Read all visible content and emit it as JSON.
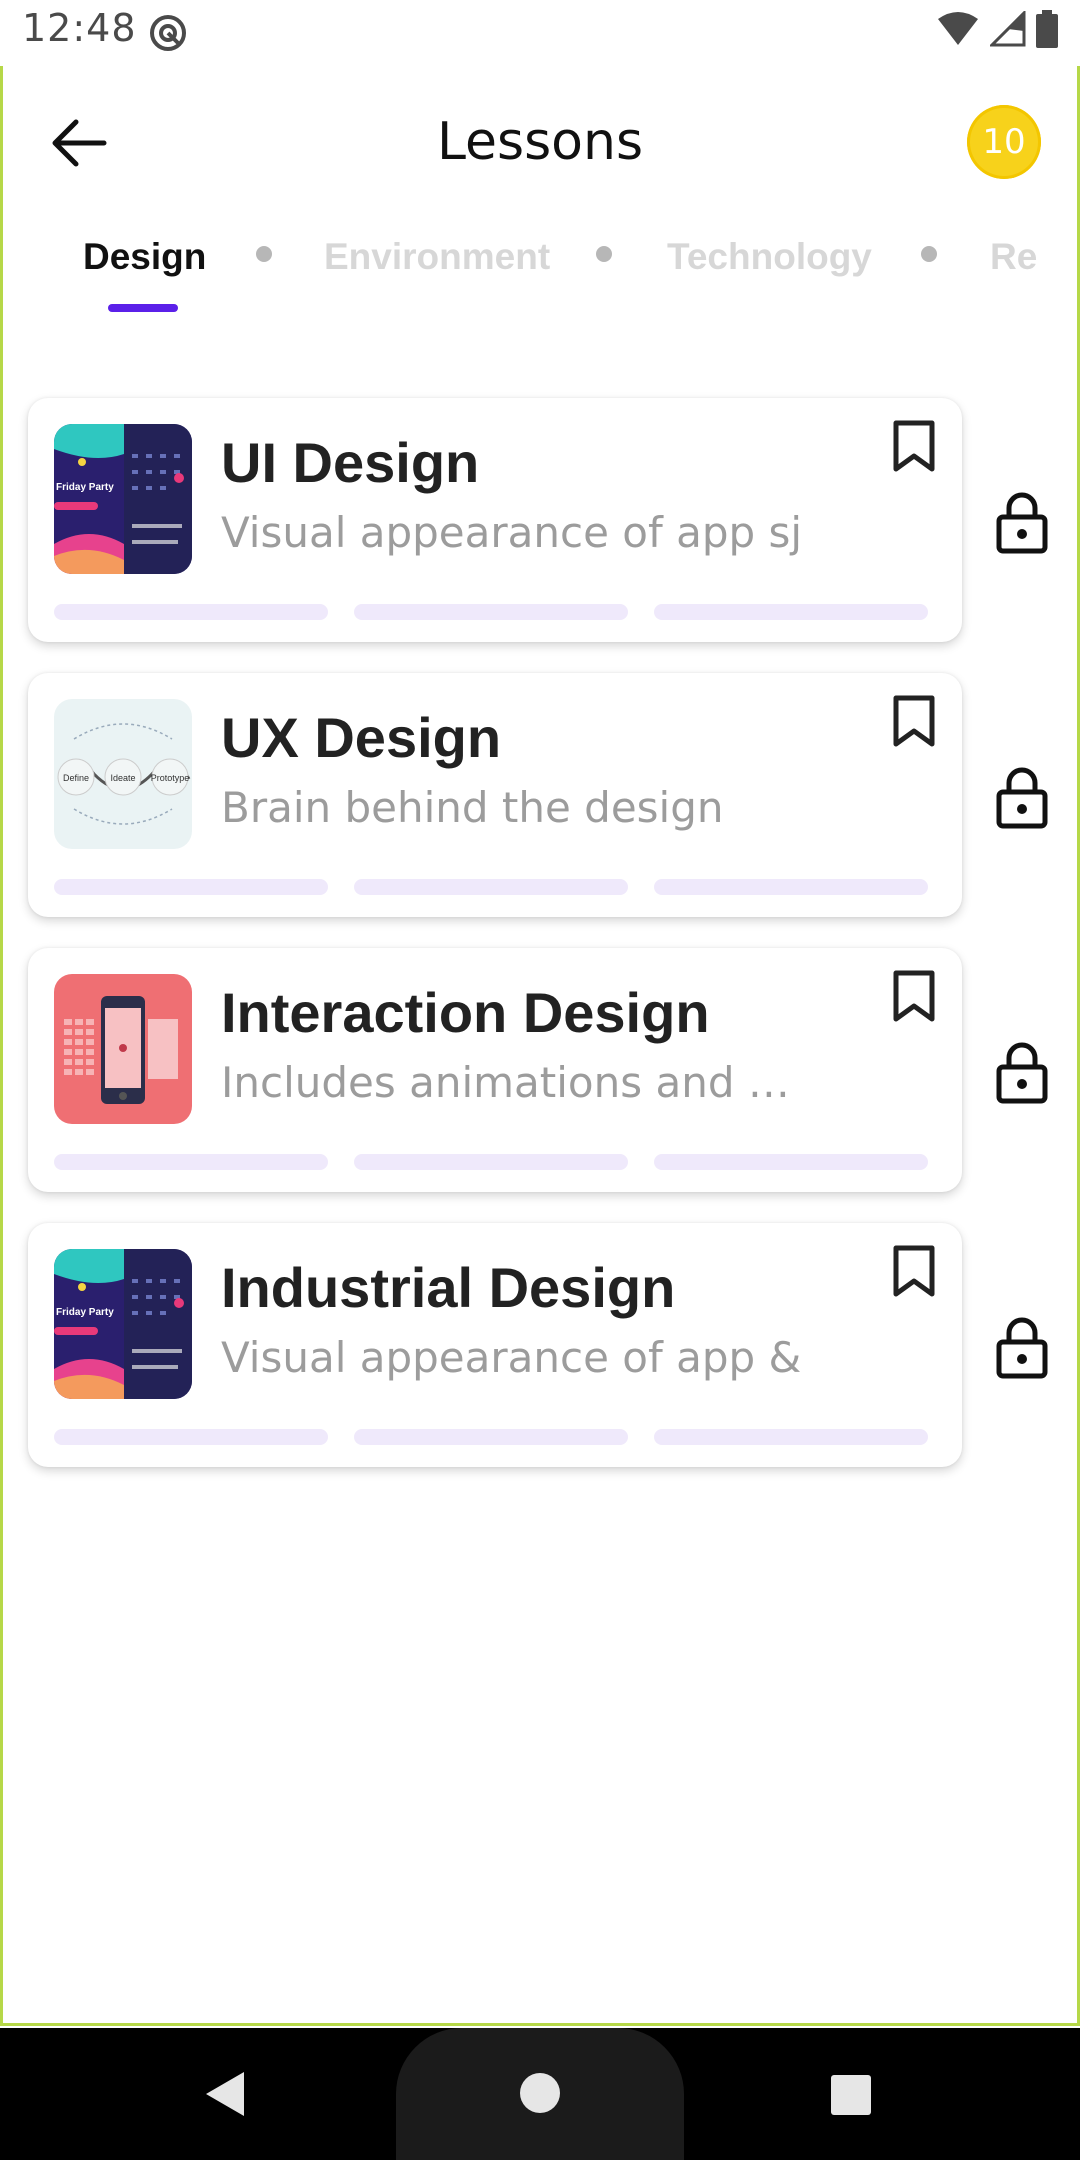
{
  "status_bar": {
    "time": "12:48"
  },
  "header": {
    "title": "Lessons",
    "coin_count": "10"
  },
  "tabs": [
    {
      "label": "Design",
      "active": true
    },
    {
      "label": "Environment",
      "active": false
    },
    {
      "label": "Technology",
      "active": false
    },
    {
      "label": "Re",
      "active": false
    }
  ],
  "lessons": [
    {
      "title": "UI Design",
      "subtitle": "Visual appearance of app sjd",
      "thumbnail": "party-app-thumbnail",
      "locked": true
    },
    {
      "title": "UX Design",
      "subtitle": "Brain behind the design",
      "thumbnail": "ux-process-thumbnail",
      "locked": true
    },
    {
      "title": "Interaction Design",
      "subtitle": "Includes animations and …",
      "thumbnail": "phone-mockup-thumbnail",
      "locked": true
    },
    {
      "title": "Industrial Design",
      "subtitle": "Visual appearance of app & …",
      "thumbnail": "party-app-thumbnail",
      "locked": true
    }
  ],
  "thumbnail_text": {
    "party": "Friday Party",
    "ux": [
      "Define",
      "Ideate",
      "Prototype"
    ]
  },
  "colors": {
    "accent": "#5b20e9",
    "coin": "#f7d21b",
    "progress_track": "#efe9fb",
    "frame_border": "#b6d848"
  }
}
